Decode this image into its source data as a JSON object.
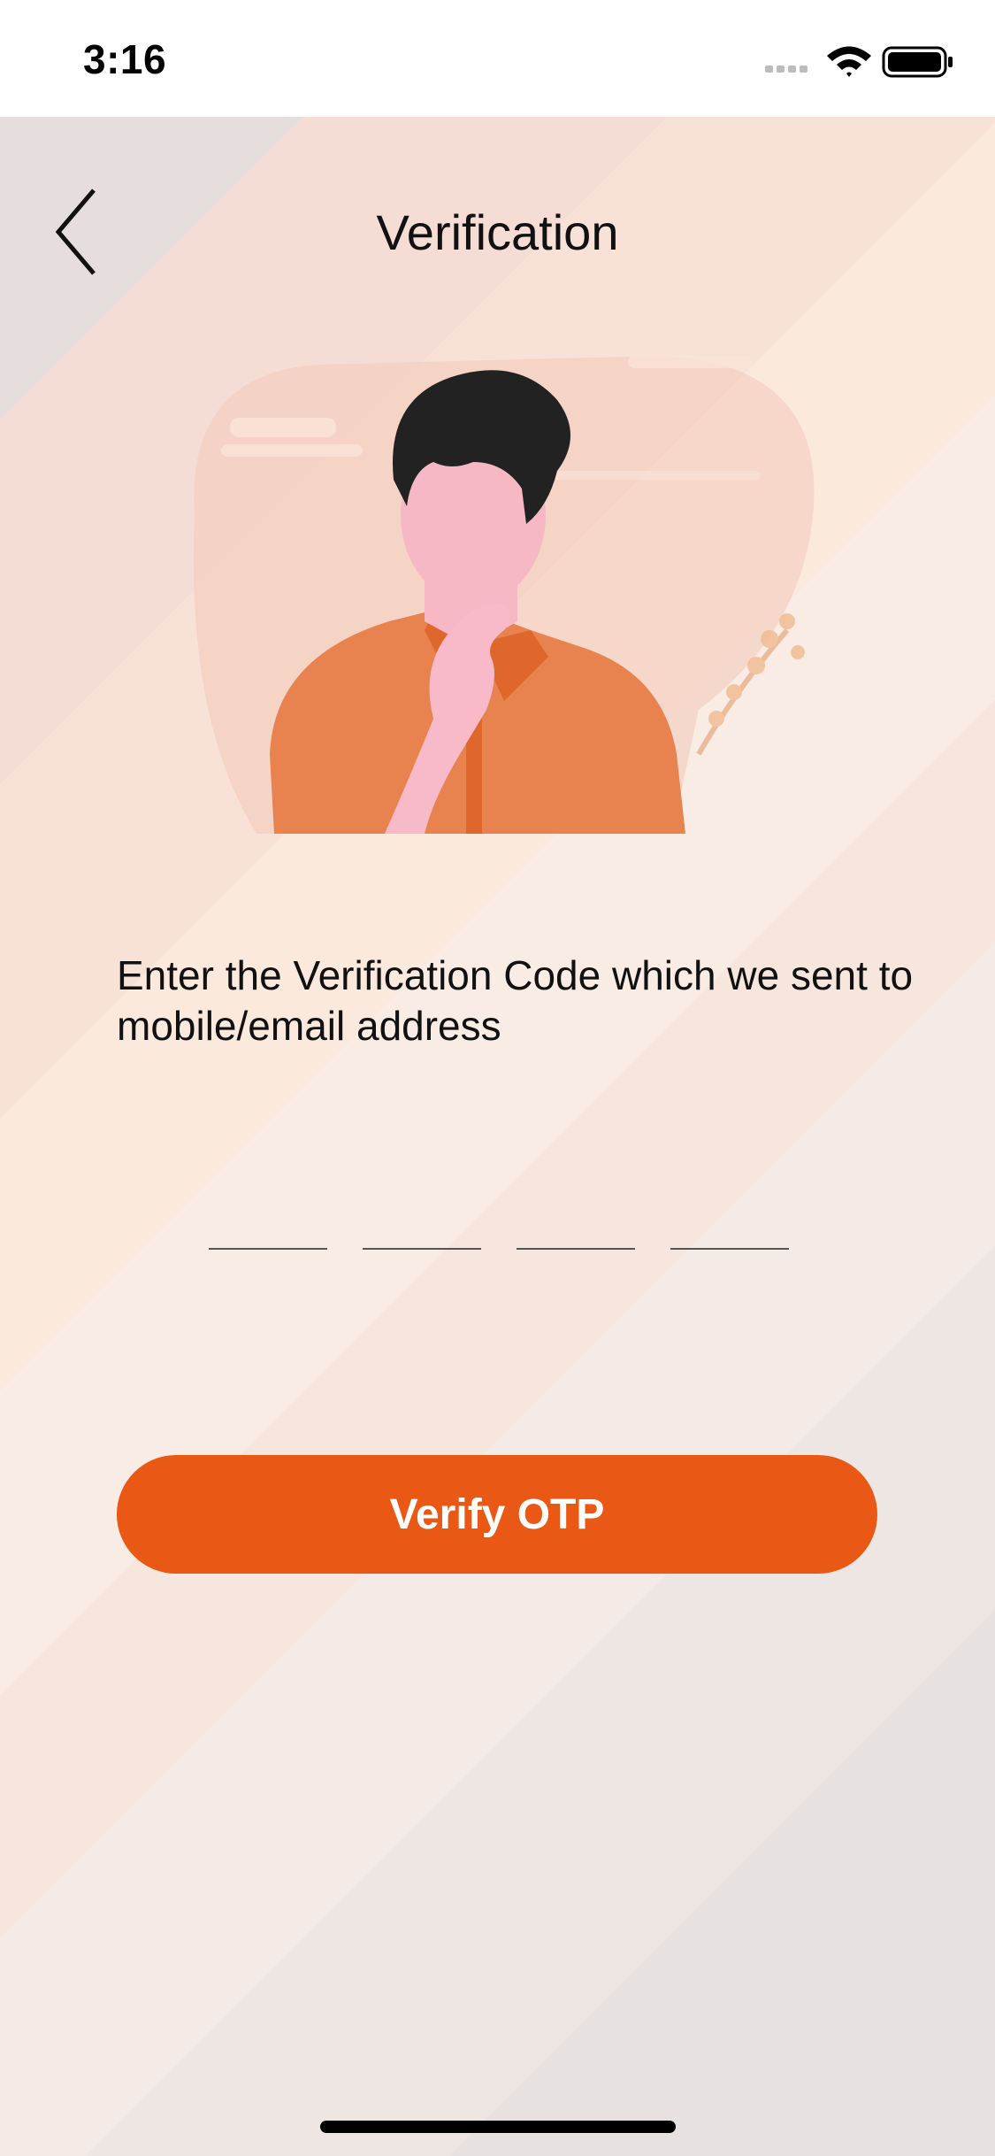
{
  "status_bar": {
    "time": "3:16",
    "icons": [
      "signal-icon",
      "wifi-icon",
      "battery-icon"
    ]
  },
  "header": {
    "title": "Verification",
    "back_icon": "chevron-left-icon"
  },
  "illustration": {
    "name": "thinking-person-illustration"
  },
  "instruction": {
    "text": "Enter the Verification Code which we sent to mobile/email address"
  },
  "otp": {
    "digits": [
      "",
      "",
      "",
      ""
    ]
  },
  "verify_button": {
    "label": "Verify OTP"
  },
  "colors": {
    "accent": "#e95814",
    "shirt": "#e8834f",
    "skin": "#f5b8c4",
    "hair": "#222222"
  }
}
